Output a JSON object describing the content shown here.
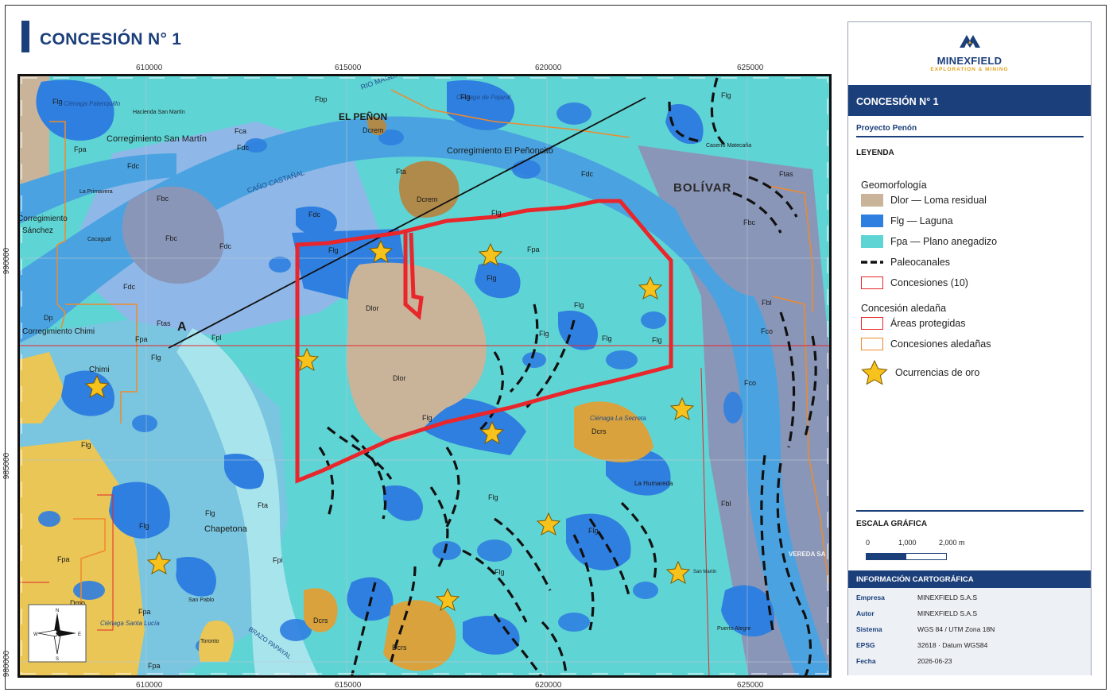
{
  "title": "CONCESIÓN N° 1",
  "map": {
    "x_ticks": [
      "610000",
      "615000",
      "620000",
      "625000"
    ],
    "y_ticks": [
      "990000",
      "985000",
      "980000"
    ],
    "labels": {
      "el_penon": "EL PEÑON",
      "bolivar": "BOLÍVAR",
      "rio_magdalena": "RIO MAGDALENA",
      "corr_penoncito": "Corregimiento El Peñoncito",
      "corr_san_martin": "Corregimiento San Martín",
      "hacienda": "Hacienda San Martín",
      "cienaga_palenquillo": "Ciénaga Palenquillo",
      "cienaga_pajaral": "Ciénaga de Pajaral",
      "cano_castanal": "CAÑO CASTAÑAL",
      "la_primavera": "La Primavera",
      "cacagual": "Cacagual",
      "sanchez": "Sánchez",
      "caserio": "Caserío Matecaña",
      "corr_chimi": "Corregimiento Chimi",
      "chimi": "Chimi",
      "chapetona": "Chapetona",
      "la_humareda": "La Humareda",
      "cienaga_secreta": "Ciénaga La Secreta",
      "puerto_alegre": "Puerto Alegre",
      "san_pablo": "San Pablo",
      "toronto": "Toronto",
      "brazo_papayal": "BRAZO PAPAYAL",
      "vereda": "VEREDA SA",
      "san_martin_r": "San Martín",
      "cienaga_santa_lucia": "Ciénaga Santa Lucía",
      "corrimiento": "Corregimiento",
      "a": "A"
    },
    "units": {
      "dlor": "Dlor",
      "dcrem": "Dcrem",
      "dcrs": "Dcrs",
      "flg": "Flg",
      "fpa": "Fpa",
      "fdc": "Fdc",
      "fbc": "Fbc",
      "fca": "Fca",
      "fbp": "Fbp",
      "fta": "Fta",
      "ftas": "Ftas",
      "fco": "Fco",
      "fbl": "Fbl",
      "fpi": "Fpi",
      "dp": "Dp",
      "dmo": "Dmo",
      "fpl": "Fpl"
    },
    "colors": {
      "fpa": "#5fd4d4",
      "flg": "#2f7fe0",
      "river": "#4aa3e0",
      "dlor": "#c9b49a",
      "dcrs": "#d9a23c",
      "fdc": "#8fb8e8",
      "fbc": "#8a96b8",
      "yellow": "#e9c655",
      "concession": "#e8262b",
      "neighbor": "#f08a2a",
      "gold": "#f7c21c"
    }
  },
  "panel": {
    "logo_name": "MINEXFIELD",
    "logo_sub": "EXPLORATION & MINING",
    "header": "CONCESIÓN N° 1",
    "project": "Proyecto Penón",
    "legend_label": "LEYENDA",
    "geomorph_title": "Geomorfología",
    "legend": {
      "dlor": "Dlor — Loma residual",
      "flg": "Flg — Laguna",
      "fpa": "Fpa — Plano anegadizo",
      "paleo": "Paleocanales",
      "conc": "Concesiones (10)"
    },
    "neighbor_title": "Concesión aledaña",
    "neighbor": {
      "protected": "Áreas protegidas",
      "neighbors": "Concesiones aledañas",
      "gold": "Ocurrencias de oro"
    },
    "scale_title": "ESCALA GRÁFICA",
    "scale": {
      "l0": "0",
      "l1": "1,000",
      "l2": "2,000 m"
    },
    "info_title": "INFORMACIÓN CARTOGRÁFICA",
    "info": [
      {
        "k": "Empresa",
        "v": "MINEXFIELD S.A.S"
      },
      {
        "k": "Autor",
        "v": "MINEXFIELD S.A.S"
      },
      {
        "k": "Sistema",
        "v": "WGS 84 / UTM Zona 18N"
      },
      {
        "k": "EPSG",
        "v": "32618  ·  Datum WGS84"
      },
      {
        "k": "Fecha",
        "v": "2026-06-23"
      }
    ]
  }
}
